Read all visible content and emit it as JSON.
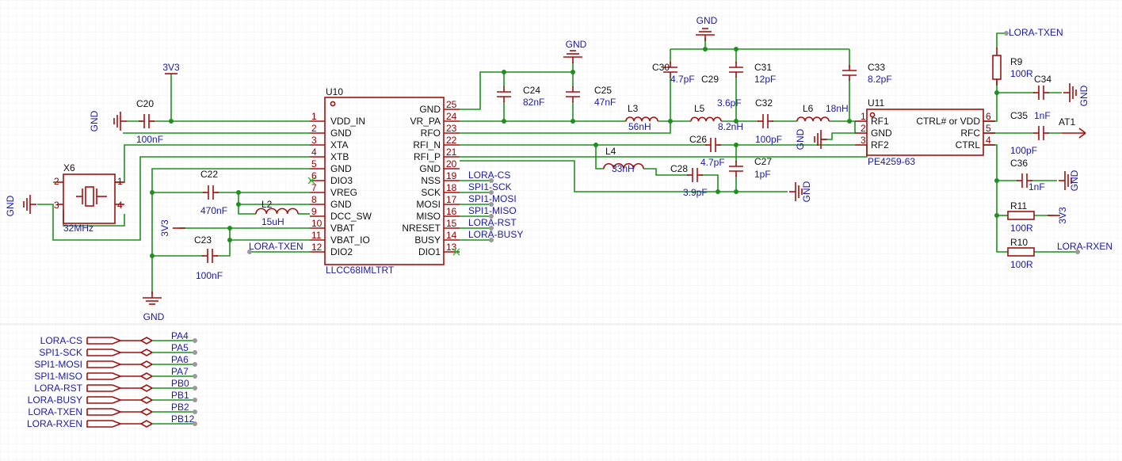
{
  "u10": {
    "ref": "U10",
    "part": "LLCC68IMLTRT",
    "left_pins": [
      {
        "num": "1",
        "name": "VDD_IN"
      },
      {
        "num": "2",
        "name": "GND"
      },
      {
        "num": "3",
        "name": "XTA"
      },
      {
        "num": "4",
        "name": "XTB"
      },
      {
        "num": "5",
        "name": "GND"
      },
      {
        "num": "6",
        "name": "DIO3"
      },
      {
        "num": "7",
        "name": "VREG"
      },
      {
        "num": "8",
        "name": "GND"
      },
      {
        "num": "9",
        "name": "DCC_SW"
      },
      {
        "num": "10",
        "name": "VBAT"
      },
      {
        "num": "11",
        "name": "VBAT_IO"
      },
      {
        "num": "12",
        "name": "DIO2"
      }
    ],
    "right_pins": [
      {
        "num": "25",
        "name": "GND"
      },
      {
        "num": "24",
        "name": "VR_PA"
      },
      {
        "num": "23",
        "name": "RFO"
      },
      {
        "num": "22",
        "name": "RFI_N"
      },
      {
        "num": "21",
        "name": "RFI_P"
      },
      {
        "num": "20",
        "name": "GND"
      },
      {
        "num": "19",
        "name": "NSS"
      },
      {
        "num": "18",
        "name": "SCK"
      },
      {
        "num": "17",
        "name": "MOSI"
      },
      {
        "num": "16",
        "name": "MISO"
      },
      {
        "num": "15",
        "name": "NRESET"
      },
      {
        "num": "14",
        "name": "BUSY"
      },
      {
        "num": "13",
        "name": "DIO1"
      }
    ]
  },
  "u11": {
    "ref": "U11",
    "part": "PE4259-63",
    "left_pins": [
      {
        "num": "1",
        "name": "RF1"
      },
      {
        "num": "2",
        "name": "GND"
      },
      {
        "num": "3",
        "name": "RF2"
      }
    ],
    "right_pins": [
      {
        "num": "6",
        "name": "CTRL# or VDD"
      },
      {
        "num": "5",
        "name": "RFC"
      },
      {
        "num": "4",
        "name": "CTRL"
      }
    ]
  },
  "x6": {
    "ref": "X6",
    "value": "32MHz",
    "pins": [
      "2",
      "1",
      "3",
      "4"
    ]
  },
  "components": [
    {
      "key": "C20",
      "ref": "C20",
      "value": "100nF"
    },
    {
      "key": "C22",
      "ref": "C22",
      "value": "470nF"
    },
    {
      "key": "C23",
      "ref": "C23",
      "value": "100nF"
    },
    {
      "key": "L2",
      "ref": "L2",
      "value": "15uH"
    },
    {
      "key": "C24",
      "ref": "C24",
      "value": "82nF"
    },
    {
      "key": "C25",
      "ref": "C25",
      "value": "47nF"
    },
    {
      "key": "L3",
      "ref": "L3",
      "value": "56nH"
    },
    {
      "key": "C30",
      "ref": "C30",
      "value": "4.7pF"
    },
    {
      "key": "C29",
      "ref": "C29",
      "value": "3.6pF"
    },
    {
      "key": "C31",
      "ref": "C31",
      "value": "12pF"
    },
    {
      "key": "L5",
      "ref": "L5",
      "value": "8.2nH"
    },
    {
      "key": "C32",
      "ref": "C32",
      "value": "100pF"
    },
    {
      "key": "L6",
      "ref": "L6",
      "value": "18nH"
    },
    {
      "key": "C33",
      "ref": "C33",
      "value": "8.2pF"
    },
    {
      "key": "L4",
      "ref": "L4",
      "value": "33nH"
    },
    {
      "key": "C26",
      "ref": "C26",
      "value": "4.7pF"
    },
    {
      "key": "C27",
      "ref": "C27",
      "value": "1pF"
    },
    {
      "key": "C28",
      "ref": "C28",
      "value": "3.9pF"
    },
    {
      "key": "R9",
      "ref": "R9",
      "value": "100R"
    },
    {
      "key": "C34",
      "ref": "C34",
      "value": ""
    },
    {
      "key": "C35",
      "ref": "C35",
      "value": "1nF"
    },
    {
      "key": "C35b",
      "ref": "",
      "value": "100pF"
    },
    {
      "key": "C36",
      "ref": "C36",
      "value": "1nF"
    },
    {
      "key": "R11",
      "ref": "R11",
      "value": "100R"
    },
    {
      "key": "R10",
      "ref": "R10",
      "value": "100R"
    },
    {
      "key": "AT1",
      "ref": "AT1",
      "value": ""
    }
  ],
  "power": {
    "gnd": "GND",
    "v33": "3V3"
  },
  "nets": {
    "lora_cs": "LORA-CS",
    "spi1_sck": "SPI1-SCK",
    "spi1_mosi": "SPI1-MOSI",
    "spi1_miso": "SPI1-MISO",
    "lora_rst": "LORA-RST",
    "lora_busy": "LORA-BUSY",
    "lora_txen": "LORA-TXEN",
    "lora_rxen": "LORA-RXEN"
  },
  "port_map": [
    {
      "net": "LORA-CS",
      "pin": "PA4"
    },
    {
      "net": "SPI1-SCK",
      "pin": "PA5"
    },
    {
      "net": "SPI1-MOSI",
      "pin": "PA6"
    },
    {
      "net": "SPI1-MISO",
      "pin": "PA7"
    },
    {
      "net": "LORA-RST",
      "pin": "PB0"
    },
    {
      "net": "LORA-BUSY",
      "pin": "PB1"
    },
    {
      "net": "LORA-TXEN",
      "pin": "PB2"
    },
    {
      "net": "LORA-RXEN",
      "pin": "PB12"
    }
  ]
}
